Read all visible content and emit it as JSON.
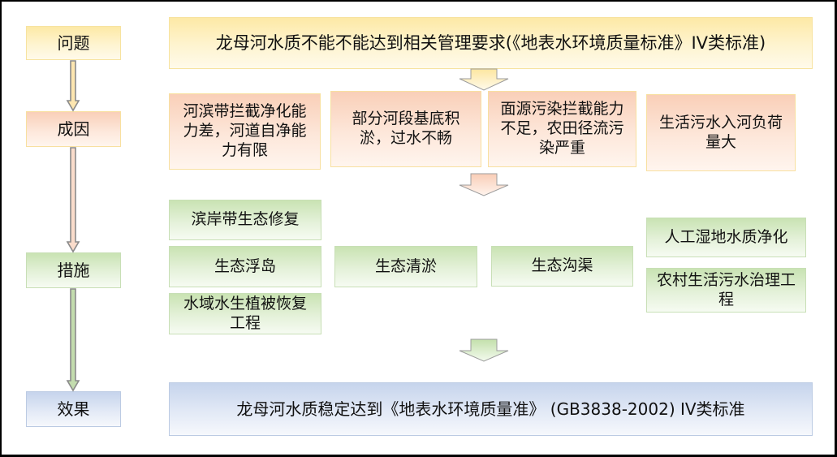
{
  "stages": [
    {
      "key": "problem",
      "label": "问题",
      "color": "#fde9a6"
    },
    {
      "key": "cause",
      "label": "成因",
      "color": "#f9cfb8"
    },
    {
      "key": "measure",
      "label": "措施",
      "color": "#c9e3b3"
    },
    {
      "key": "effect",
      "label": "效果",
      "color": "#c6d4ec"
    }
  ],
  "problem": {
    "text": "龙母河水质不能不能达到相关管理要求(《地表水环境质量标准》IV类标准)"
  },
  "causes": [
    "河滨带拦截净化能力差，河道自净能力有限",
    "部分河段基底积淤，过水不畅",
    "面源污染拦截能力不足，农田径流污染严重",
    "生活污水入河负荷量大"
  ],
  "measures": {
    "column1": [
      "滨岸带生态修复",
      "生态浮岛",
      "水域水生植被恢复工程"
    ],
    "column2": [
      "生态清淤"
    ],
    "column3": [
      "生态沟渠"
    ],
    "column4": [
      "人工湿地水质净化",
      "农村生活污水治理工程"
    ]
  },
  "effect": {
    "text": "龙母河水质稳定达到《地表水环境质量准》 (GB3838-2002) IV类标准"
  },
  "arrow_icons": {
    "stage_arrow": "down-arrow-icon",
    "block_arrow": "block-down-arrow-icon"
  }
}
